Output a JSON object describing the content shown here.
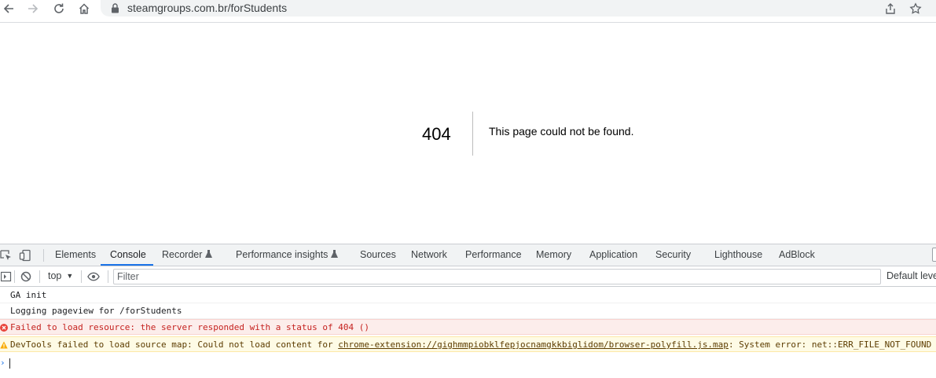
{
  "browser": {
    "url": "steamgroups.com.br/forStudents",
    "icons": {
      "back": "arrow-left-icon",
      "forward": "arrow-right-icon",
      "reload": "reload-icon",
      "home": "home-icon",
      "lock": "lock-icon",
      "share": "share-icon",
      "bookmark": "star-icon"
    }
  },
  "page": {
    "error_code": "404",
    "error_message": "This page could not be found."
  },
  "devtools": {
    "tabs": [
      {
        "label": "Elements"
      },
      {
        "label": "Console"
      },
      {
        "label": "Recorder"
      },
      {
        "label": "Performance insights"
      },
      {
        "label": "Sources"
      },
      {
        "label": "Network"
      },
      {
        "label": "Performance"
      },
      {
        "label": "Memory"
      },
      {
        "label": "Application"
      },
      {
        "label": "Security"
      },
      {
        "label": "Lighthouse"
      },
      {
        "label": "AdBlock"
      }
    ],
    "active_tab": "Console",
    "context": "top",
    "filter_placeholder": "Filter",
    "levels_label": "Default levels",
    "messages": [
      {
        "level": "log",
        "text": "GA init"
      },
      {
        "level": "log",
        "text": "Logging pageview for /forStudents"
      },
      {
        "level": "error",
        "text": "Failed to load resource: the server responded with a status of 404 ()"
      },
      {
        "level": "warning",
        "text_prefix": "DevTools failed to load source map: Could not load content for ",
        "link": "chrome-extension://gighmmpiobklfepjocnamgkkbiglidom/browser-polyfill.js.map",
        "text_suffix": ": System error: net::ERR_FILE_NOT_FOUND"
      }
    ],
    "prompt_symbol": "›"
  },
  "colors": {
    "accent": "#1a73e8",
    "error_bg": "#fcedeb",
    "error_text": "#c5221f",
    "warning_bg": "#fefbe5",
    "warning_icon": "#f9ab00"
  }
}
